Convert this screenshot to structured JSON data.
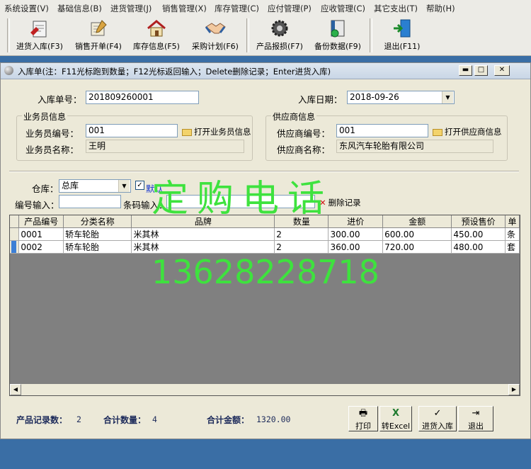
{
  "menu": [
    "系统设置(V)",
    "基础信息(B)",
    "进货管理(J)",
    "销售管理(X)",
    "库存管理(C)",
    "应付管理(P)",
    "应收管理(C)",
    "其它支出(T)",
    "帮助(H)"
  ],
  "toolbar": {
    "purchase_in": "进货入库(F3)",
    "sales_order": "销售开单(F4)",
    "stock_info": "库存信息(F5)",
    "purchase_plan": "采购计划(F6)",
    "product_loss": "产品报损(F7)",
    "backup": "备份数据(F9)",
    "exit": "退出(F11)"
  },
  "window": {
    "title": "入库单(注：F11光标跑到数量；F12光标返回输入；Delete删除记录；Enter进货入库)",
    "min": "▬",
    "max": "□",
    "close": "✕"
  },
  "form": {
    "order_no_label": "入库单号：",
    "order_no": "201809260001",
    "date_label": "入库日期：",
    "date": "2018-09-26",
    "staff_group": "业务员信息",
    "staff_no_label": "业务员编号：",
    "staff_no": "001",
    "open_staff": "打开业务员信息",
    "staff_name_label": "业务员名称：",
    "staff_name": "王明",
    "supplier_group": "供应商信息",
    "supplier_no_label": "供应商编号：",
    "supplier_no": "001",
    "open_supplier": "打开供应商信息",
    "supplier_name_label": "供应商名称：",
    "supplier_name": "东风汽车轮胎有限公司",
    "warehouse_label": "仓库：",
    "warehouse": "总库",
    "default_label": "默认",
    "code_input_label": "编号输入：",
    "code_input": "",
    "barcode_label": "条码输入：",
    "barcode": "",
    "delete_record": "删除记录"
  },
  "table": {
    "headers": [
      "产品编号",
      "分类名称",
      "品牌",
      "数量",
      "进价",
      "金额",
      "预设售价",
      "单"
    ],
    "rows": [
      [
        "0001",
        "轿车轮胎",
        "米其林",
        "2",
        "300.00",
        "600.00",
        "450.00",
        "条"
      ],
      [
        "0002",
        "轿车轮胎",
        "米其林",
        "2",
        "360.00",
        "720.00",
        "480.00",
        "套"
      ]
    ]
  },
  "footer": {
    "record_count_label": "产品记录数：",
    "record_count": "2",
    "total_qty_label": "合计数量：",
    "total_qty": "4",
    "total_amount_label": "合计金额：",
    "total_amount": "1320.00",
    "print": "打印",
    "excel": "转Excel",
    "stock_in": "进货入库",
    "exit": "退出"
  },
  "watermark": {
    "line1": "定购电话",
    "line2": "13628228718"
  }
}
